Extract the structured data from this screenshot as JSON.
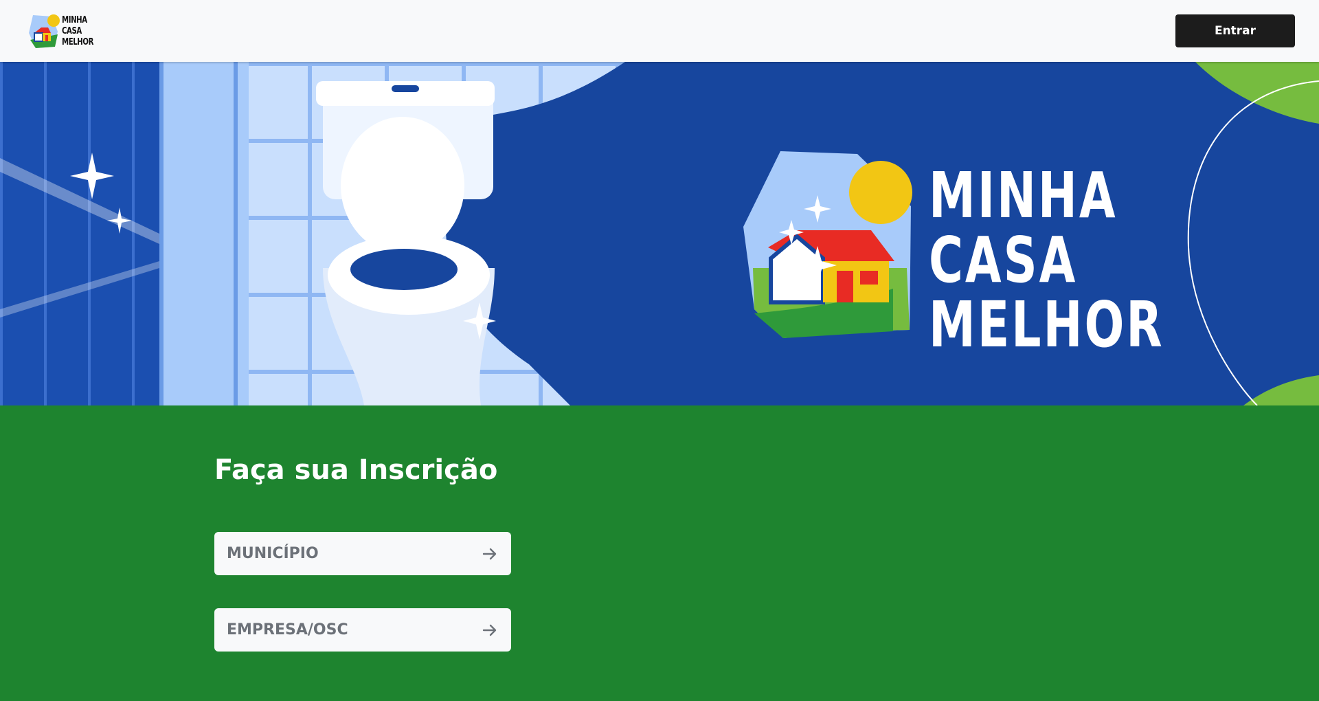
{
  "header": {
    "logo_lines": [
      "MINHA",
      "CASA",
      "MELHOR"
    ],
    "enter_label": "Entrar"
  },
  "banner": {
    "brand_lines": [
      "MINHA",
      "CASA",
      "MELHOR"
    ]
  },
  "main": {
    "title": "Faça sua Inscrição",
    "options": [
      {
        "label": "MUNICÍPIO",
        "icon": "arrow-right-icon"
      },
      {
        "label": "EMPRESA/OSC",
        "icon": "arrow-right-icon"
      }
    ]
  },
  "colors": {
    "header_bg": "#f8f9fa",
    "button_bg": "#1c1c1c",
    "banner_blue": "#17469e",
    "light_blue": "#a8cbfa",
    "green": "#1e842f",
    "light_green": "#76bc3f",
    "yellow": "#f2c614",
    "red": "#e82b24",
    "option_text": "#6c7178"
  }
}
